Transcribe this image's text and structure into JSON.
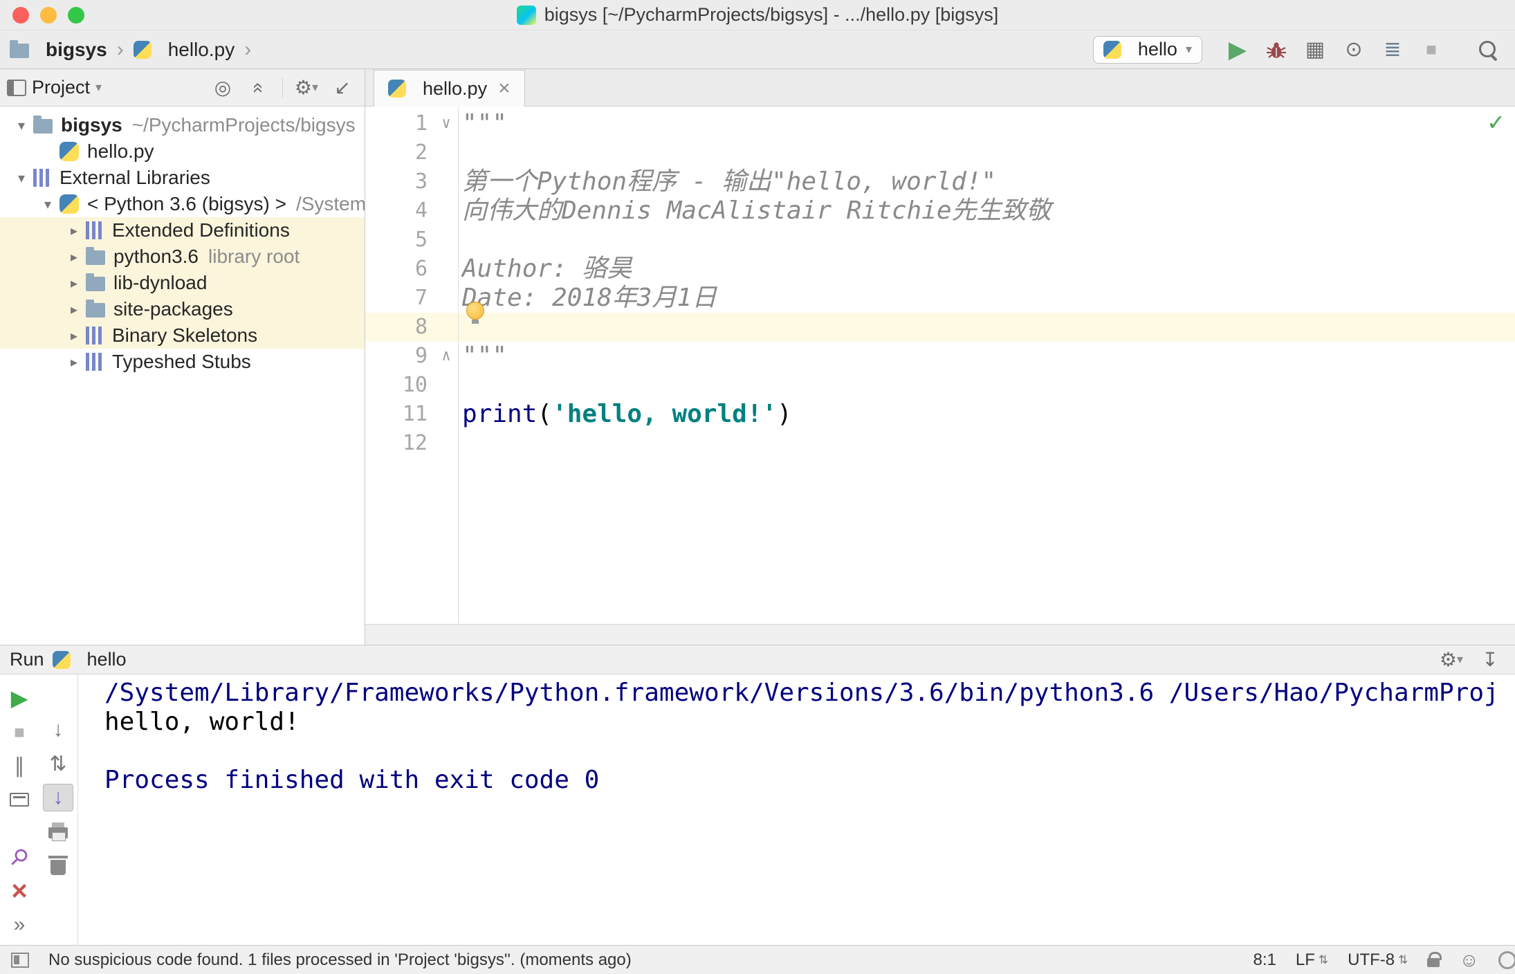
{
  "titlebar": {
    "title": "bigsys [~/PycharmProjects/bigsys] - .../hello.py [bigsys]"
  },
  "toolbar": {
    "breadcrumbs": {
      "project": "bigsys",
      "file": "hello.py"
    },
    "run_config": "hello"
  },
  "project_panel": {
    "title": "Project",
    "tree": [
      {
        "label": "bigsys",
        "suffix": "~/PycharmProjects/bigsys",
        "level": 0,
        "chevron": "down",
        "icon": "folder",
        "bold": true,
        "highlight": false
      },
      {
        "label": "hello.py",
        "suffix": "",
        "level": 1,
        "chevron": "none",
        "icon": "pyfile",
        "bold": false,
        "highlight": false
      },
      {
        "label": "External Libraries",
        "suffix": "",
        "level": 0,
        "chevron": "down",
        "icon": "lib",
        "bold": false,
        "highlight": false
      },
      {
        "label": "< Python 3.6 (bigsys) >",
        "suffix": "/System",
        "level": 1,
        "chevron": "down",
        "icon": "python",
        "bold": false,
        "highlight": false
      },
      {
        "label": "Extended Definitions",
        "suffix": "",
        "level": 2,
        "chevron": "right",
        "icon": "lib",
        "bold": false,
        "highlight": true
      },
      {
        "label": "python3.6",
        "suffix": "library root",
        "level": 2,
        "chevron": "right",
        "icon": "folder",
        "bold": false,
        "highlight": true
      },
      {
        "label": "lib-dynload",
        "suffix": "",
        "level": 2,
        "chevron": "right",
        "icon": "folder",
        "bold": false,
        "highlight": true
      },
      {
        "label": "site-packages",
        "suffix": "",
        "level": 2,
        "chevron": "right",
        "icon": "folder",
        "bold": false,
        "highlight": true
      },
      {
        "label": "Binary Skeletons",
        "suffix": "",
        "level": 2,
        "chevron": "right",
        "icon": "lib",
        "bold": false,
        "highlight": true
      },
      {
        "label": "Typeshed Stubs",
        "suffix": "",
        "level": 2,
        "chevron": "right",
        "icon": "lib",
        "bold": false,
        "highlight": false
      }
    ]
  },
  "editor": {
    "tab": {
      "label": "hello.py"
    },
    "colors": {
      "docstring": "#8A8A8A",
      "string": "#008080",
      "builtin": "#000080",
      "current_line": "#FFFAE3"
    },
    "lines": [
      {
        "num": 1,
        "fold": "top",
        "current": false,
        "bulb": false,
        "segs": [
          {
            "t": "\"\"\"",
            "c": "doc"
          }
        ]
      },
      {
        "num": 2,
        "fold": "",
        "current": false,
        "bulb": false,
        "segs": []
      },
      {
        "num": 3,
        "fold": "",
        "current": false,
        "bulb": false,
        "segs": [
          {
            "t": "第一个Python程序 - 输出\"hello, world!\"",
            "c": "doc"
          }
        ]
      },
      {
        "num": 4,
        "fold": "",
        "current": false,
        "bulb": false,
        "segs": [
          {
            "t": "向伟大的Dennis MacAlistair Ritchie先生致敬",
            "c": "doc"
          }
        ]
      },
      {
        "num": 5,
        "fold": "",
        "current": false,
        "bulb": false,
        "segs": []
      },
      {
        "num": 6,
        "fold": "",
        "current": false,
        "bulb": false,
        "segs": [
          {
            "t": "Author: 骆昊",
            "c": "doc"
          }
        ]
      },
      {
        "num": 7,
        "fold": "",
        "current": false,
        "bulb": true,
        "segs": [
          {
            "t": "Date: 2018年3月1日",
            "c": "doc"
          }
        ]
      },
      {
        "num": 8,
        "fold": "",
        "current": true,
        "bulb": false,
        "segs": []
      },
      {
        "num": 9,
        "fold": "bottom",
        "current": false,
        "bulb": false,
        "segs": [
          {
            "t": "\"\"\"",
            "c": "doc"
          }
        ]
      },
      {
        "num": 10,
        "fold": "",
        "current": false,
        "bulb": false,
        "segs": []
      },
      {
        "num": 11,
        "fold": "",
        "current": false,
        "bulb": false,
        "segs": [
          {
            "t": "print",
            "c": "builtin"
          },
          {
            "t": "(",
            "c": "plain"
          },
          {
            "t": "'hello, world!'",
            "c": "string"
          },
          {
            "t": ")",
            "c": "plain"
          }
        ]
      },
      {
        "num": 12,
        "fold": "",
        "current": false,
        "bulb": false,
        "segs": []
      }
    ]
  },
  "run_panel": {
    "title": "Run",
    "config": "hello",
    "console_lines": [
      {
        "text": "/System/Library/Frameworks/Python.framework/Versions/3.6/bin/python3.6 /Users/Hao/PycharmProj",
        "kind": "system"
      },
      {
        "text": "hello, world!",
        "kind": "stdout"
      },
      {
        "text": "",
        "kind": "stdout"
      },
      {
        "text": "Process finished with exit code 0",
        "kind": "system"
      }
    ]
  },
  "statusbar": {
    "message": "No suspicious code found. 1 files processed in 'Project 'bigsys''. (moments ago)",
    "caret": "8:1",
    "line_separator": "LF",
    "encoding": "UTF-8"
  },
  "colors": {
    "run_green": "#59A869",
    "cream_highlight": "#FBF5DC",
    "console_system": "#000080",
    "string_teal": "#008080",
    "debug_bug": "#99494A"
  },
  "icons": {
    "breadcrumb_chevron": "›",
    "dropdown_chevron": "▾",
    "tree_chevron_down": "▾",
    "tree_chevron_right": "▸",
    "run": "▶",
    "rerun": "▶",
    "stop": "■",
    "coverage": "▦",
    "profiler": "⊙",
    "concurrency": "≣",
    "locate": "◎",
    "collapse": "«",
    "gear": "⚙",
    "hide": "↙",
    "hide_down": "↧",
    "pause": "∥",
    "pin": "⚲",
    "close": "×",
    "close_tab": "×",
    "more": "»",
    "down": "↓",
    "updown": "⇅",
    "scroll_end": "↓",
    "check": "✓",
    "fold_top": "∨",
    "fold_bottom": "∧",
    "hector": "☺",
    "updown_small": "⇅"
  }
}
